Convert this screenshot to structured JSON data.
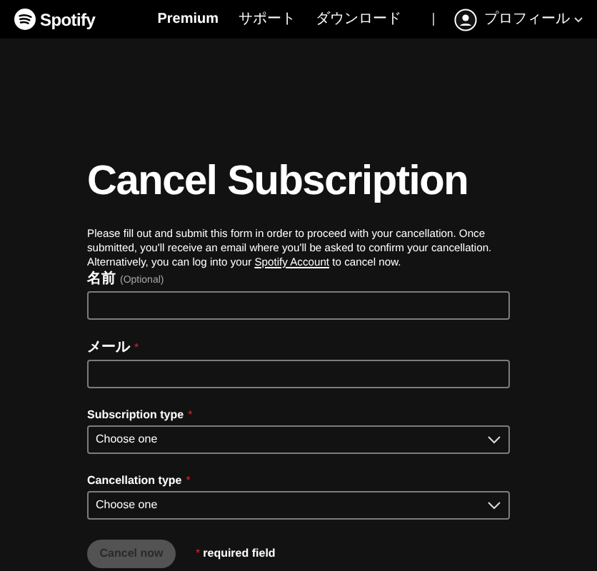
{
  "header": {
    "logo": "Spotify",
    "nav": [
      {
        "label": "Premium",
        "bold": true
      },
      {
        "label": "サポート",
        "bold": false
      },
      {
        "label": "ダウンロード",
        "bold": false
      }
    ],
    "profile": {
      "label": "プロフィール"
    }
  },
  "title": "Cancel Subscription",
  "intro": {
    "before": "Please fill out and submit this form in order to proceed with your cancellation. Once submitted, you'll receive an email where you'll be asked to confirm your cancellation. Alternatively, you can log into your ",
    "link": "Spotify Account",
    "after": " to cancel now."
  },
  "fields": [
    {
      "kind": "text",
      "label": "名前",
      "note": "(Optional)",
      "required": false
    },
    {
      "kind": "text",
      "label": "メール",
      "required": true
    },
    {
      "kind": "select",
      "label": "Subscription type",
      "required": true,
      "value": "Choose one"
    },
    {
      "kind": "select",
      "label": "Cancellation type",
      "required": true,
      "value": "Choose one"
    }
  ],
  "submit": {
    "label": "Cancel now",
    "disabled": true
  },
  "required_note": {
    "mark": "*",
    "text": "required field"
  }
}
